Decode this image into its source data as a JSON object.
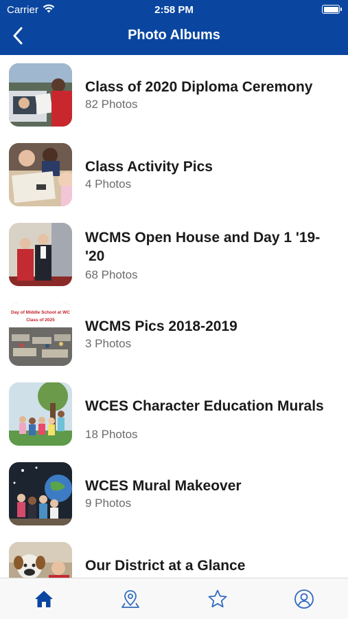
{
  "status_bar": {
    "carrier": "Carrier",
    "time": "2:58 PM"
  },
  "navbar": {
    "title": "Photo Albums",
    "back_icon": "chevron-left-icon"
  },
  "albums": [
    {
      "title": "Class of 2020 Diploma Ceremony",
      "count": "82 Photos"
    },
    {
      "title": "Class Activity Pics",
      "count": "4 Photos"
    },
    {
      "title": "WCMS Open House and Day 1 '19-'20",
      "count": "68 Photos"
    },
    {
      "title": "WCMS Pics 2018-2019",
      "count": "3 Photos",
      "thumb_text": "Day of Middle School at WC Class of 2025"
    },
    {
      "title": "WCES Character Education Murals",
      "count": "18 Photos"
    },
    {
      "title": "WCES Mural Makeover",
      "count": "9 Photos"
    },
    {
      "title": "Our District at a Glance",
      "count": ""
    }
  ],
  "tab_bar": {
    "tabs": [
      {
        "icon": "home-icon",
        "active": true
      },
      {
        "icon": "map-pin-icon",
        "active": false
      },
      {
        "icon": "star-icon",
        "active": false
      },
      {
        "icon": "profile-icon",
        "active": false
      }
    ]
  },
  "colors": {
    "brand": "#0a46a0",
    "active_tab": "#0a46a0",
    "inactive_tab": "#2f6bc0"
  }
}
